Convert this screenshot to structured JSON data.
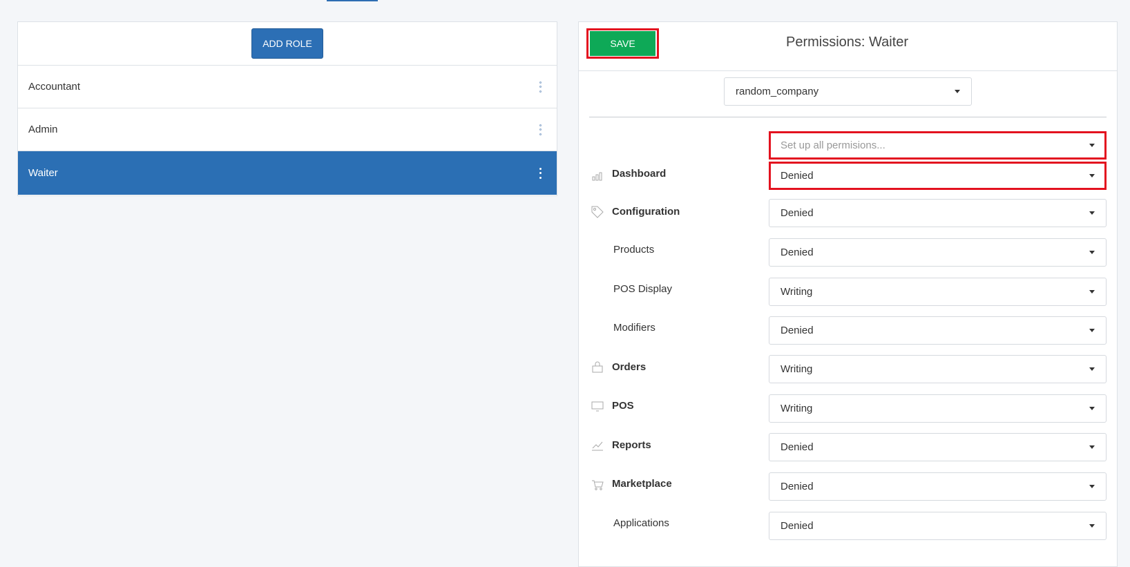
{
  "roles_panel": {
    "add_role_label": "ADD ROLE",
    "roles": [
      {
        "name": "Accountant",
        "active": false
      },
      {
        "name": "Admin",
        "active": false
      },
      {
        "name": "Waiter",
        "active": true
      }
    ]
  },
  "permissions_panel": {
    "save_label": "SAVE",
    "title": "Permissions: Waiter",
    "company_select": "random_company",
    "set_all_placeholder": "Set up all permisions...",
    "rows": [
      {
        "label": "Dashboard",
        "value": "Denied",
        "icon": "dashboard-icon",
        "sub": false
      },
      {
        "label": "Configuration",
        "value": "Denied",
        "icon": "tag-icon",
        "sub": false
      },
      {
        "label": "Products",
        "value": "Denied",
        "icon": "",
        "sub": true
      },
      {
        "label": "POS Display",
        "value": "Writing",
        "icon": "",
        "sub": true
      },
      {
        "label": "Modifiers",
        "value": "Denied",
        "icon": "",
        "sub": true
      },
      {
        "label": "Orders",
        "value": "Writing",
        "icon": "orders-icon",
        "sub": false
      },
      {
        "label": "POS",
        "value": "Writing",
        "icon": "pos-icon",
        "sub": false
      },
      {
        "label": "Reports",
        "value": "Denied",
        "icon": "reports-icon",
        "sub": false
      },
      {
        "label": "Marketplace",
        "value": "Denied",
        "icon": "cart-icon",
        "sub": false
      },
      {
        "label": "Applications",
        "value": "Denied",
        "icon": "",
        "sub": true
      }
    ]
  },
  "colors": {
    "primary": "#2c6fb5",
    "save": "#0ea957",
    "highlight": "#e3121f"
  }
}
